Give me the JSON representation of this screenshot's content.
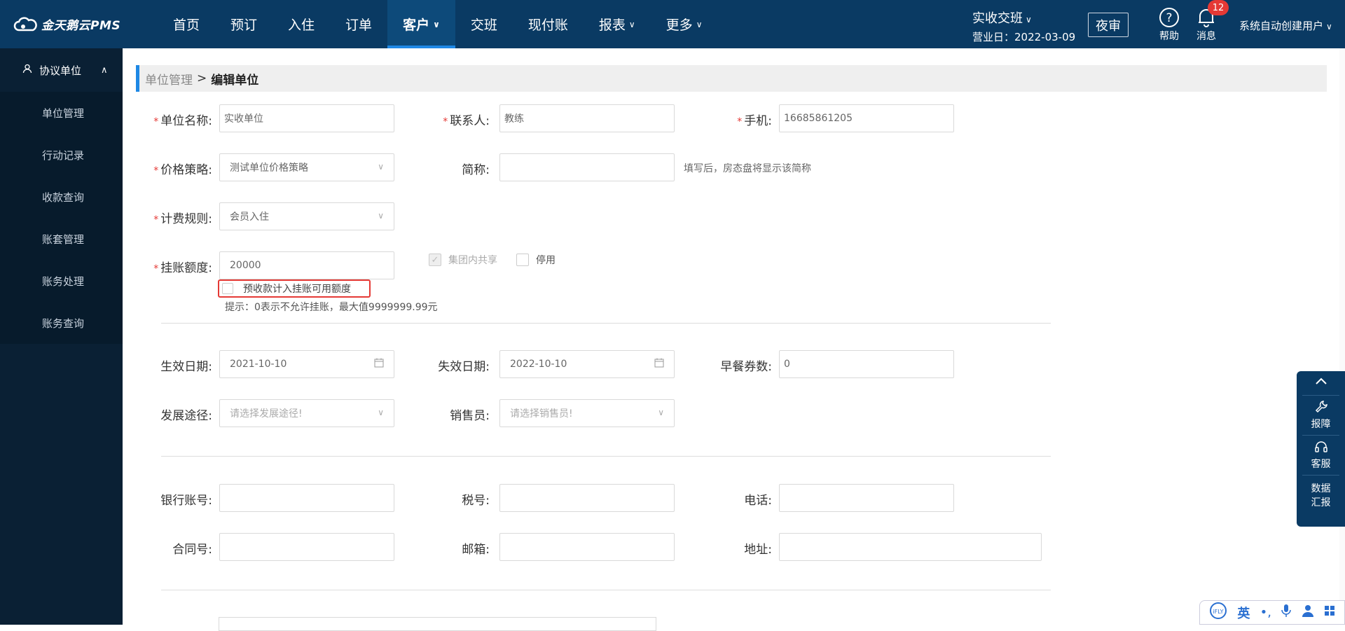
{
  "app": {
    "brand": "金天鹅云PMS"
  },
  "nav": {
    "items": [
      {
        "label": "首页"
      },
      {
        "label": "预订"
      },
      {
        "label": "入住"
      },
      {
        "label": "订单"
      },
      {
        "label": "客户",
        "dropdown": true,
        "active": true
      },
      {
        "label": "交班"
      },
      {
        "label": "现付账"
      },
      {
        "label": "报表",
        "dropdown": true
      },
      {
        "label": "更多",
        "dropdown": true
      }
    ]
  },
  "header": {
    "shift": "实收交班",
    "business_date": "营业日：2022-03-09",
    "night_audit": "夜审",
    "help": "帮助",
    "messages": "消息",
    "message_count": "12",
    "user": "系统自动创建用户"
  },
  "sidebar": {
    "group": "协议单位",
    "items": [
      "单位管理",
      "行动记录",
      "收款查询",
      "账套管理",
      "账务处理",
      "账务查询"
    ]
  },
  "breadcrumb": {
    "parent": "单位管理",
    "separator": ">",
    "current": "编辑单位"
  },
  "form": {
    "unit_name": {
      "label": "单位名称:",
      "value": "实收单位"
    },
    "contact": {
      "label": "联系人:",
      "value": "教练"
    },
    "phone": {
      "label": "手机:",
      "value": "16685861205"
    },
    "price_policy": {
      "label": "价格策略:",
      "value": "测试单位价格策略"
    },
    "short_name": {
      "label": "简称:",
      "value": "",
      "hint": "填写后，房态盘将显示该简称"
    },
    "billing_rule": {
      "label": "计费规则:",
      "value": "会员入住"
    },
    "credit_limit": {
      "label": "挂账额度:",
      "value": "20000"
    },
    "group_share": {
      "label": "集团内共享",
      "checked": true
    },
    "disabled": {
      "label": "停用",
      "checked": false
    },
    "prepaid_in_credit": {
      "label": "预收款计入挂账可用额度",
      "checked": false
    },
    "credit_hint": "提示：0表示不允许挂账，最大值9999999.99元",
    "start_date": {
      "label": "生效日期:",
      "value": "2021-10-10"
    },
    "end_date": {
      "label": "失效日期:",
      "value": "2022-10-10"
    },
    "breakfast": {
      "label": "早餐券数:",
      "value": "0"
    },
    "channel": {
      "label": "发展途径:",
      "placeholder": "请选择发展途径!"
    },
    "salesman": {
      "label": "销售员:",
      "placeholder": "请选择销售员!"
    },
    "bank_account": {
      "label": "银行账号:",
      "value": ""
    },
    "tax_no": {
      "label": "税号:",
      "value": ""
    },
    "tel": {
      "label": "电话:",
      "value": ""
    },
    "contract_no": {
      "label": "合同号:",
      "value": ""
    },
    "email": {
      "label": "邮箱:",
      "value": ""
    },
    "address": {
      "label": "地址:",
      "value": ""
    }
  },
  "float_panel": {
    "report": "报障",
    "service": "客服",
    "data_line1": "数据",
    "data_line2": "汇报"
  },
  "ime": {
    "lang": "英"
  },
  "colors": {
    "topbar": "#0a3a63",
    "sidebar": "#0a2034",
    "accent": "#1e88e5",
    "required": "#e53935"
  }
}
